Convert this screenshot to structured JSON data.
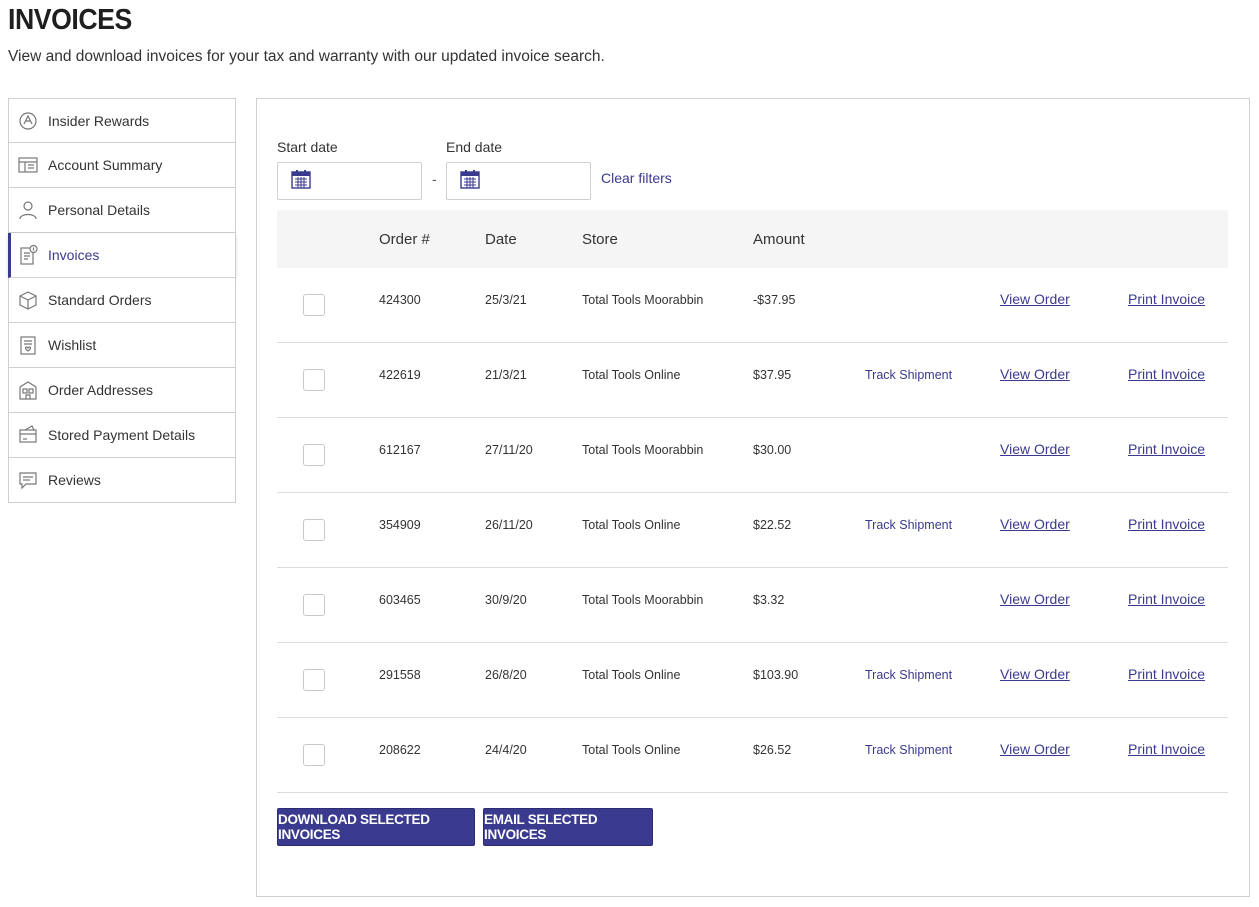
{
  "header": {
    "title": "INVOICES",
    "subtitle": "View and download invoices for your tax and warranty with our updated invoice search."
  },
  "sidebar": {
    "items": [
      {
        "label": "Insider Rewards",
        "icon": "rewards-icon"
      },
      {
        "label": "Account Summary",
        "icon": "account-summary-icon"
      },
      {
        "label": "Personal Details",
        "icon": "person-icon"
      },
      {
        "label": "Invoices",
        "icon": "invoice-icon",
        "active": true
      },
      {
        "label": "Standard Orders",
        "icon": "box-icon"
      },
      {
        "label": "Wishlist",
        "icon": "wishlist-icon"
      },
      {
        "label": "Order Addresses",
        "icon": "address-icon"
      },
      {
        "label": "Stored Payment Details",
        "icon": "card-icon"
      },
      {
        "label": "Reviews",
        "icon": "reviews-icon"
      }
    ]
  },
  "filters": {
    "start_label": "Start date",
    "end_label": "End date",
    "separator": "-",
    "clear_label": "Clear filters"
  },
  "table": {
    "headers": {
      "order": "Order #",
      "date": "Date",
      "store": "Store",
      "amount": "Amount"
    },
    "track_label": "Track Shipment",
    "view_label": "View Order",
    "print_label": "Print Invoice",
    "rows": [
      {
        "order": "424300",
        "date": "25/3/21",
        "store": "Total Tools Moorabbin",
        "amount": "-$37.95",
        "track": ""
      },
      {
        "order": "422619",
        "date": "21/3/21",
        "store": "Total Tools Online",
        "amount": "$37.95",
        "track": "Track Shipment"
      },
      {
        "order": "612167",
        "date": "27/11/20",
        "store": "Total Tools Moorabbin",
        "amount": "$30.00",
        "track": ""
      },
      {
        "order": "354909",
        "date": "26/11/20",
        "store": "Total Tools Online",
        "amount": "$22.52",
        "track": "Track Shipment"
      },
      {
        "order": "603465",
        "date": "30/9/20",
        "store": "Total Tools Moorabbin",
        "amount": "$3.32",
        "track": ""
      },
      {
        "order": "291558",
        "date": "26/8/20",
        "store": "Total Tools Online",
        "amount": "$103.90",
        "track": "Track Shipment"
      },
      {
        "order": "208622",
        "date": "24/4/20",
        "store": "Total Tools Online",
        "amount": "$26.52",
        "track": "Track Shipment"
      }
    ]
  },
  "actions": {
    "download_label": "DOWNLOAD SELECTED INVOICES",
    "email_label": "EMAIL SELECTED INVOICES"
  },
  "colors": {
    "accent": "#3a3a8f",
    "border": "#cfcfcf",
    "header_bg": "#f5f5f5"
  }
}
